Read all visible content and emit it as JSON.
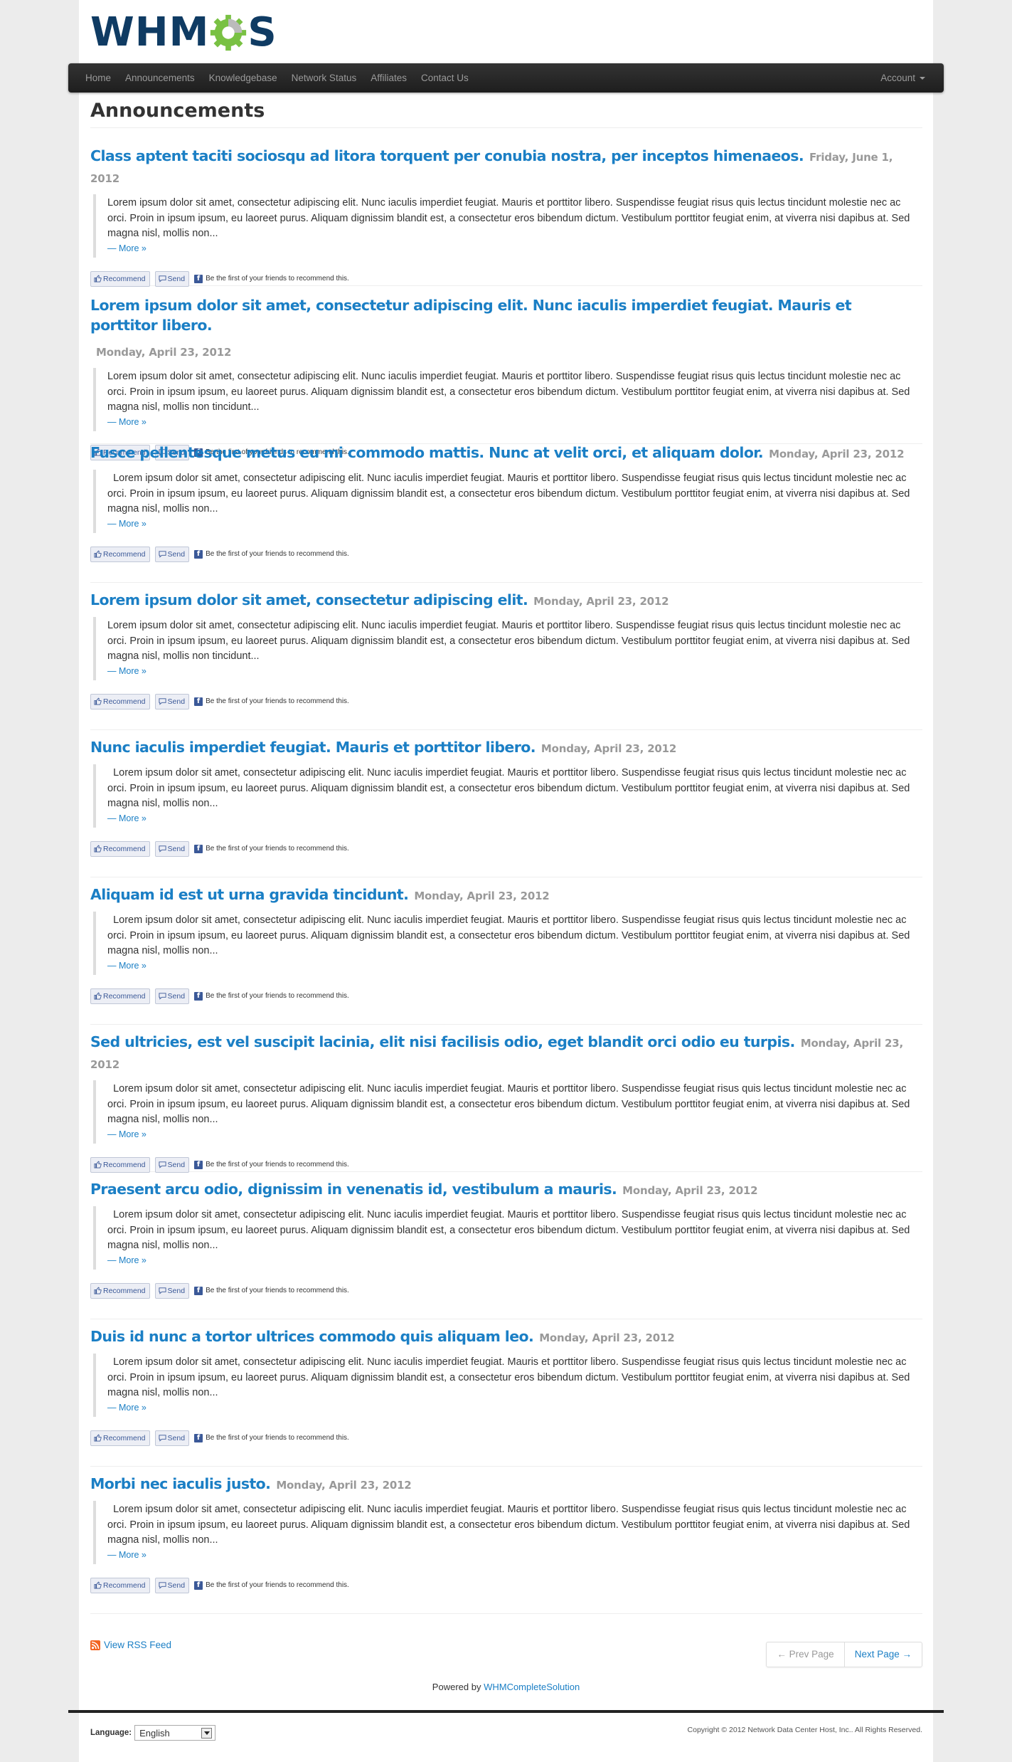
{
  "brand": {
    "logo_text_left": "WHM",
    "logo_text_right": "S",
    "logo_colors": {
      "dark": "#0f3b63",
      "gear": "#79c143"
    }
  },
  "nav": {
    "items": [
      {
        "label": "Home"
      },
      {
        "label": "Announcements"
      },
      {
        "label": "Knowledgebase"
      },
      {
        "label": "Network Status"
      },
      {
        "label": "Affiliates"
      },
      {
        "label": "Contact Us"
      }
    ],
    "account_label": "Account"
  },
  "page_title": "Announcements",
  "social": {
    "recommend_label": "Recommend",
    "send_label": "Send",
    "note": "Be the first of your friends to recommend this."
  },
  "more_label": "— More »",
  "announcements": [
    {
      "title": "Class aptent taciti sociosqu ad litora torquent per conubia nostra, per inceptos himenaeos.",
      "date": "Friday, June 1, 2012",
      "body": "Lorem ipsum dolor sit amet, consectetur adipiscing elit. Nunc iaculis imperdiet feugiat. Mauris et porttitor libero. Suspendisse feugiat risus quis lectus tincidunt molestie nec ac orci. Proin in ipsum ipsum, eu laoreet purus. Aliquam dignissim blandit est, a consectetur eros bibendum dictum. Vestibulum porttitor feugiat enim, at viverra nisi dapibus at. Sed magna nisl, mollis non..."
    },
    {
      "title": "Lorem ipsum dolor sit amet, consectetur adipiscing elit. Nunc iaculis imperdiet feugiat. Mauris et porttitor libero.",
      "date": "Monday, April 23, 2012",
      "body": "Lorem ipsum dolor sit amet, consectetur adipiscing elit. Nunc iaculis imperdiet feugiat. Mauris et porttitor libero. Suspendisse feugiat risus quis lectus tincidunt molestie nec ac orci. Proin in ipsum ipsum, eu laoreet purus. Aliquam dignissim blandit est, a consectetur eros bibendum dictum. Vestibulum porttitor feugiat enim, at viverra nisi dapibus at. Sed magna nisl, mollis non tincidunt..."
    },
    {
      "title": "Fusce pellentesque metus eu mi commodo mattis. Nunc at velit orci, et aliquam dolor.",
      "date": "Monday, April 23, 2012",
      "body": "  Lorem ipsum dolor sit amet, consectetur adipiscing elit. Nunc iaculis imperdiet feugiat. Mauris et porttitor libero. Suspendisse feugiat risus quis lectus tincidunt molestie nec ac orci. Proin in ipsum ipsum, eu laoreet purus. Aliquam dignissim blandit est, a consectetur eros bibendum dictum. Vestibulum porttitor feugiat enim, at viverra nisi dapibus at. Sed magna nisl, mollis non..."
    },
    {
      "title": "Lorem ipsum dolor sit amet, consectetur adipiscing elit.",
      "date": "Monday, April 23, 2012",
      "body": "Lorem ipsum dolor sit amet, consectetur adipiscing elit. Nunc iaculis imperdiet feugiat. Mauris et porttitor libero. Suspendisse feugiat risus quis lectus tincidunt molestie nec ac orci. Proin in ipsum ipsum, eu laoreet purus. Aliquam dignissim blandit est, a consectetur eros bibendum dictum. Vestibulum porttitor feugiat enim, at viverra nisi dapibus at. Sed magna nisl, mollis non tincidunt..."
    },
    {
      "title": "Nunc iaculis imperdiet feugiat. Mauris et porttitor libero.",
      "date": "Monday, April 23, 2012",
      "body": "  Lorem ipsum dolor sit amet, consectetur adipiscing elit. Nunc iaculis imperdiet feugiat. Mauris et porttitor libero. Suspendisse feugiat risus quis lectus tincidunt molestie nec ac orci. Proin in ipsum ipsum, eu laoreet purus. Aliquam dignissim blandit est, a consectetur eros bibendum dictum. Vestibulum porttitor feugiat enim, at viverra nisi dapibus at. Sed magna nisl, mollis non..."
    },
    {
      "title": "Aliquam id est ut urna gravida tincidunt.",
      "date": "Monday, April 23, 2012",
      "body": "  Lorem ipsum dolor sit amet, consectetur adipiscing elit. Nunc iaculis imperdiet feugiat. Mauris et porttitor libero. Suspendisse feugiat risus quis lectus tincidunt molestie nec ac orci. Proin in ipsum ipsum, eu laoreet purus. Aliquam dignissim blandit est, a consectetur eros bibendum dictum. Vestibulum porttitor feugiat enim, at viverra nisi dapibus at. Sed magna nisl, mollis non..."
    },
    {
      "title": "Sed ultricies, est vel suscipit lacinia, elit nisi facilisis odio, eget blandit orci odio eu turpis.",
      "date": "Monday, April 23, 2012",
      "body": "  Lorem ipsum dolor sit amet, consectetur adipiscing elit. Nunc iaculis imperdiet feugiat. Mauris et porttitor libero. Suspendisse feugiat risus quis lectus tincidunt molestie nec ac orci. Proin in ipsum ipsum, eu laoreet purus. Aliquam dignissim blandit est, a consectetur eros bibendum dictum. Vestibulum porttitor feugiat enim, at viverra nisi dapibus at. Sed magna nisl, mollis non..."
    },
    {
      "title": "Praesent arcu odio, dignissim in venenatis id, vestibulum a mauris.",
      "date": "Monday, April 23, 2012",
      "body": "  Lorem ipsum dolor sit amet, consectetur adipiscing elit. Nunc iaculis imperdiet feugiat. Mauris et porttitor libero. Suspendisse feugiat risus quis lectus tincidunt molestie nec ac orci. Proin in ipsum ipsum, eu laoreet purus. Aliquam dignissim blandit est, a consectetur eros bibendum dictum. Vestibulum porttitor feugiat enim, at viverra nisi dapibus at. Sed magna nisl, mollis non..."
    },
    {
      "title": "Duis id nunc a tortor ultrices commodo quis aliquam leo.",
      "date": "Monday, April 23, 2012",
      "body": "  Lorem ipsum dolor sit amet, consectetur adipiscing elit. Nunc iaculis imperdiet feugiat. Mauris et porttitor libero. Suspendisse feugiat risus quis lectus tincidunt molestie nec ac orci. Proin in ipsum ipsum, eu laoreet purus. Aliquam dignissim blandit est, a consectetur eros bibendum dictum. Vestibulum porttitor feugiat enim, at viverra nisi dapibus at. Sed magna nisl, mollis non..."
    },
    {
      "title": "Morbi nec iaculis justo.",
      "date": "Monday, April 23, 2012",
      "body": "  Lorem ipsum dolor sit amet, consectetur adipiscing elit. Nunc iaculis imperdiet feugiat. Mauris et porttitor libero. Suspendisse feugiat risus quis lectus tincidunt molestie nec ac orci. Proin in ipsum ipsum, eu laoreet purus. Aliquam dignissim blandit est, a consectetur eros bibendum dictum. Vestibulum porttitor feugiat enim, at viverra nisi dapibus at. Sed magna nisl, mollis non..."
    }
  ],
  "rss_label": "View RSS Feed",
  "pager": {
    "prev_label": "← Prev Page",
    "next_label": "Next Page →"
  },
  "powered": {
    "prefix": "Powered by",
    "link": "WHMCompleteSolution"
  },
  "language": {
    "label": "Language:",
    "selected": "English"
  },
  "copyright": "Copyright © 2012 Network Data Center Host, Inc.. All Rights Reserved."
}
